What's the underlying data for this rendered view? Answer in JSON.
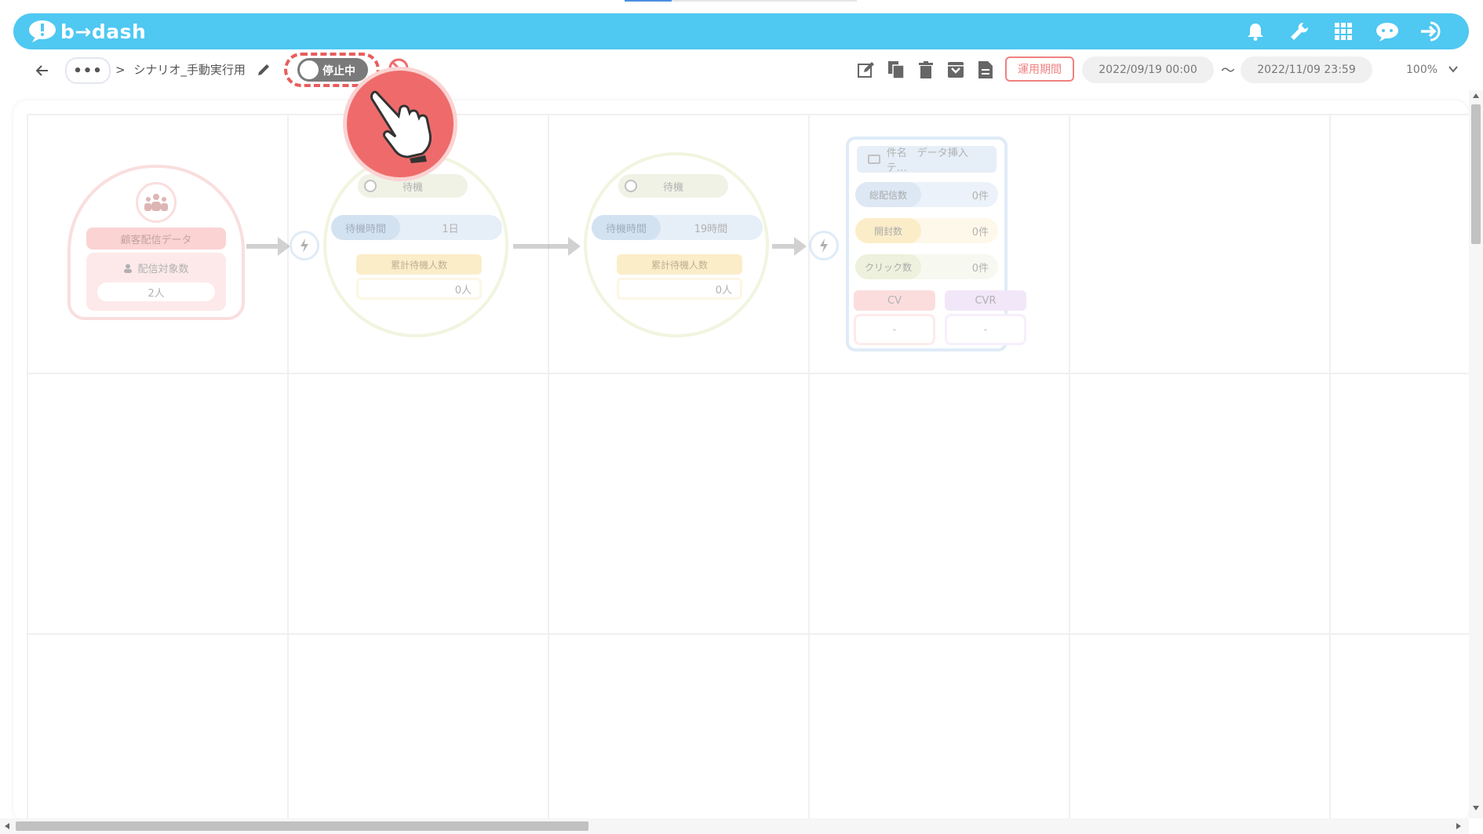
{
  "header": {
    "logo_text": "b→dash",
    "icons": [
      "bell-icon",
      "wrench-icon",
      "apps-grid-icon",
      "support-chat-icon",
      "logout-icon"
    ]
  },
  "toolbar": {
    "breadcrumb_more": "•••",
    "breadcrumb_sep": ">",
    "scenario_name": "シナリオ_手動実行用",
    "toggle_label": "停止中",
    "period_button": "運用期間",
    "start_date": "2022/09/19 00:00",
    "date_sep": "〜",
    "end_date": "2022/11/09 23:59",
    "zoom": "100%",
    "action_icons": [
      "edit-icon",
      "copy-icon",
      "trash-icon",
      "archive-icon",
      "document-icon"
    ]
  },
  "nodes": {
    "segment": {
      "title": "顧客配信データ",
      "label": "配信対象数",
      "value": "2人"
    },
    "wait1": {
      "title": "待機",
      "time_label": "待機時間",
      "time_value": "1日",
      "cum_label": "累計待機人数",
      "cum_value": "0人"
    },
    "wait2": {
      "title": "待機",
      "time_label": "待機時間",
      "time_value": "19時間",
      "cum_label": "累計待機人数",
      "cum_value": "0人"
    },
    "mail": {
      "subject": "件名　データ挿入　テ…",
      "rows": [
        {
          "label": "総配信数",
          "value": "0件"
        },
        {
          "label": "開封数",
          "value": "0件"
        },
        {
          "label": "クリック数",
          "value": "0件"
        }
      ],
      "cv_label": "CV",
      "cvr_label": "CVR",
      "cv_value": "-",
      "cvr_value": "-"
    }
  },
  "colors": {
    "header_bg": "#4fc8f2",
    "accent_red": "#ef6b6b",
    "toggle_off": "#7a7a7a"
  }
}
